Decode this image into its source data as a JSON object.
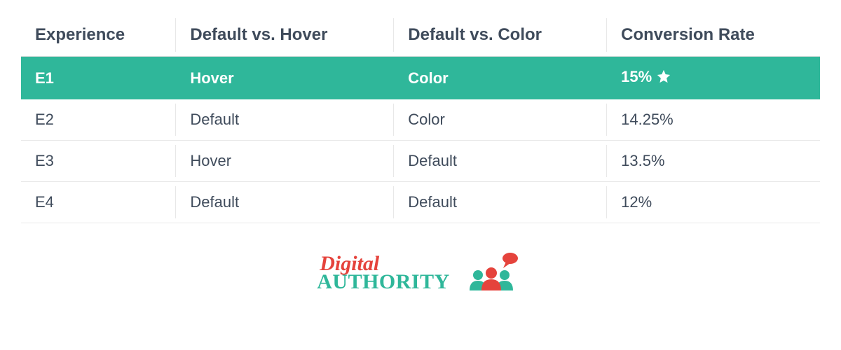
{
  "table": {
    "headers": [
      "Experience",
      "Default vs. Hover",
      "Default vs. Color",
      "Conversion Rate"
    ],
    "rows": [
      {
        "experience": "E1",
        "hover": "Hover",
        "color": "Color",
        "rate": "15%",
        "highlight": true,
        "star": true
      },
      {
        "experience": "E2",
        "hover": "Default",
        "color": "Color",
        "rate": "14.25%",
        "highlight": false,
        "star": false
      },
      {
        "experience": "E3",
        "hover": "Hover",
        "color": "Default",
        "rate": "13.5%",
        "highlight": false,
        "star": false
      },
      {
        "experience": "E4",
        "hover": "Default",
        "color": "Default",
        "rate": "12%",
        "highlight": false,
        "star": false
      }
    ]
  },
  "logo": {
    "line1": "Digital",
    "line2": "AUTHORITY"
  },
  "colors": {
    "highlight": "#2fb79a",
    "text": "#3f4b5b",
    "logo_red": "#e5433c",
    "logo_teal": "#2fb79a"
  }
}
